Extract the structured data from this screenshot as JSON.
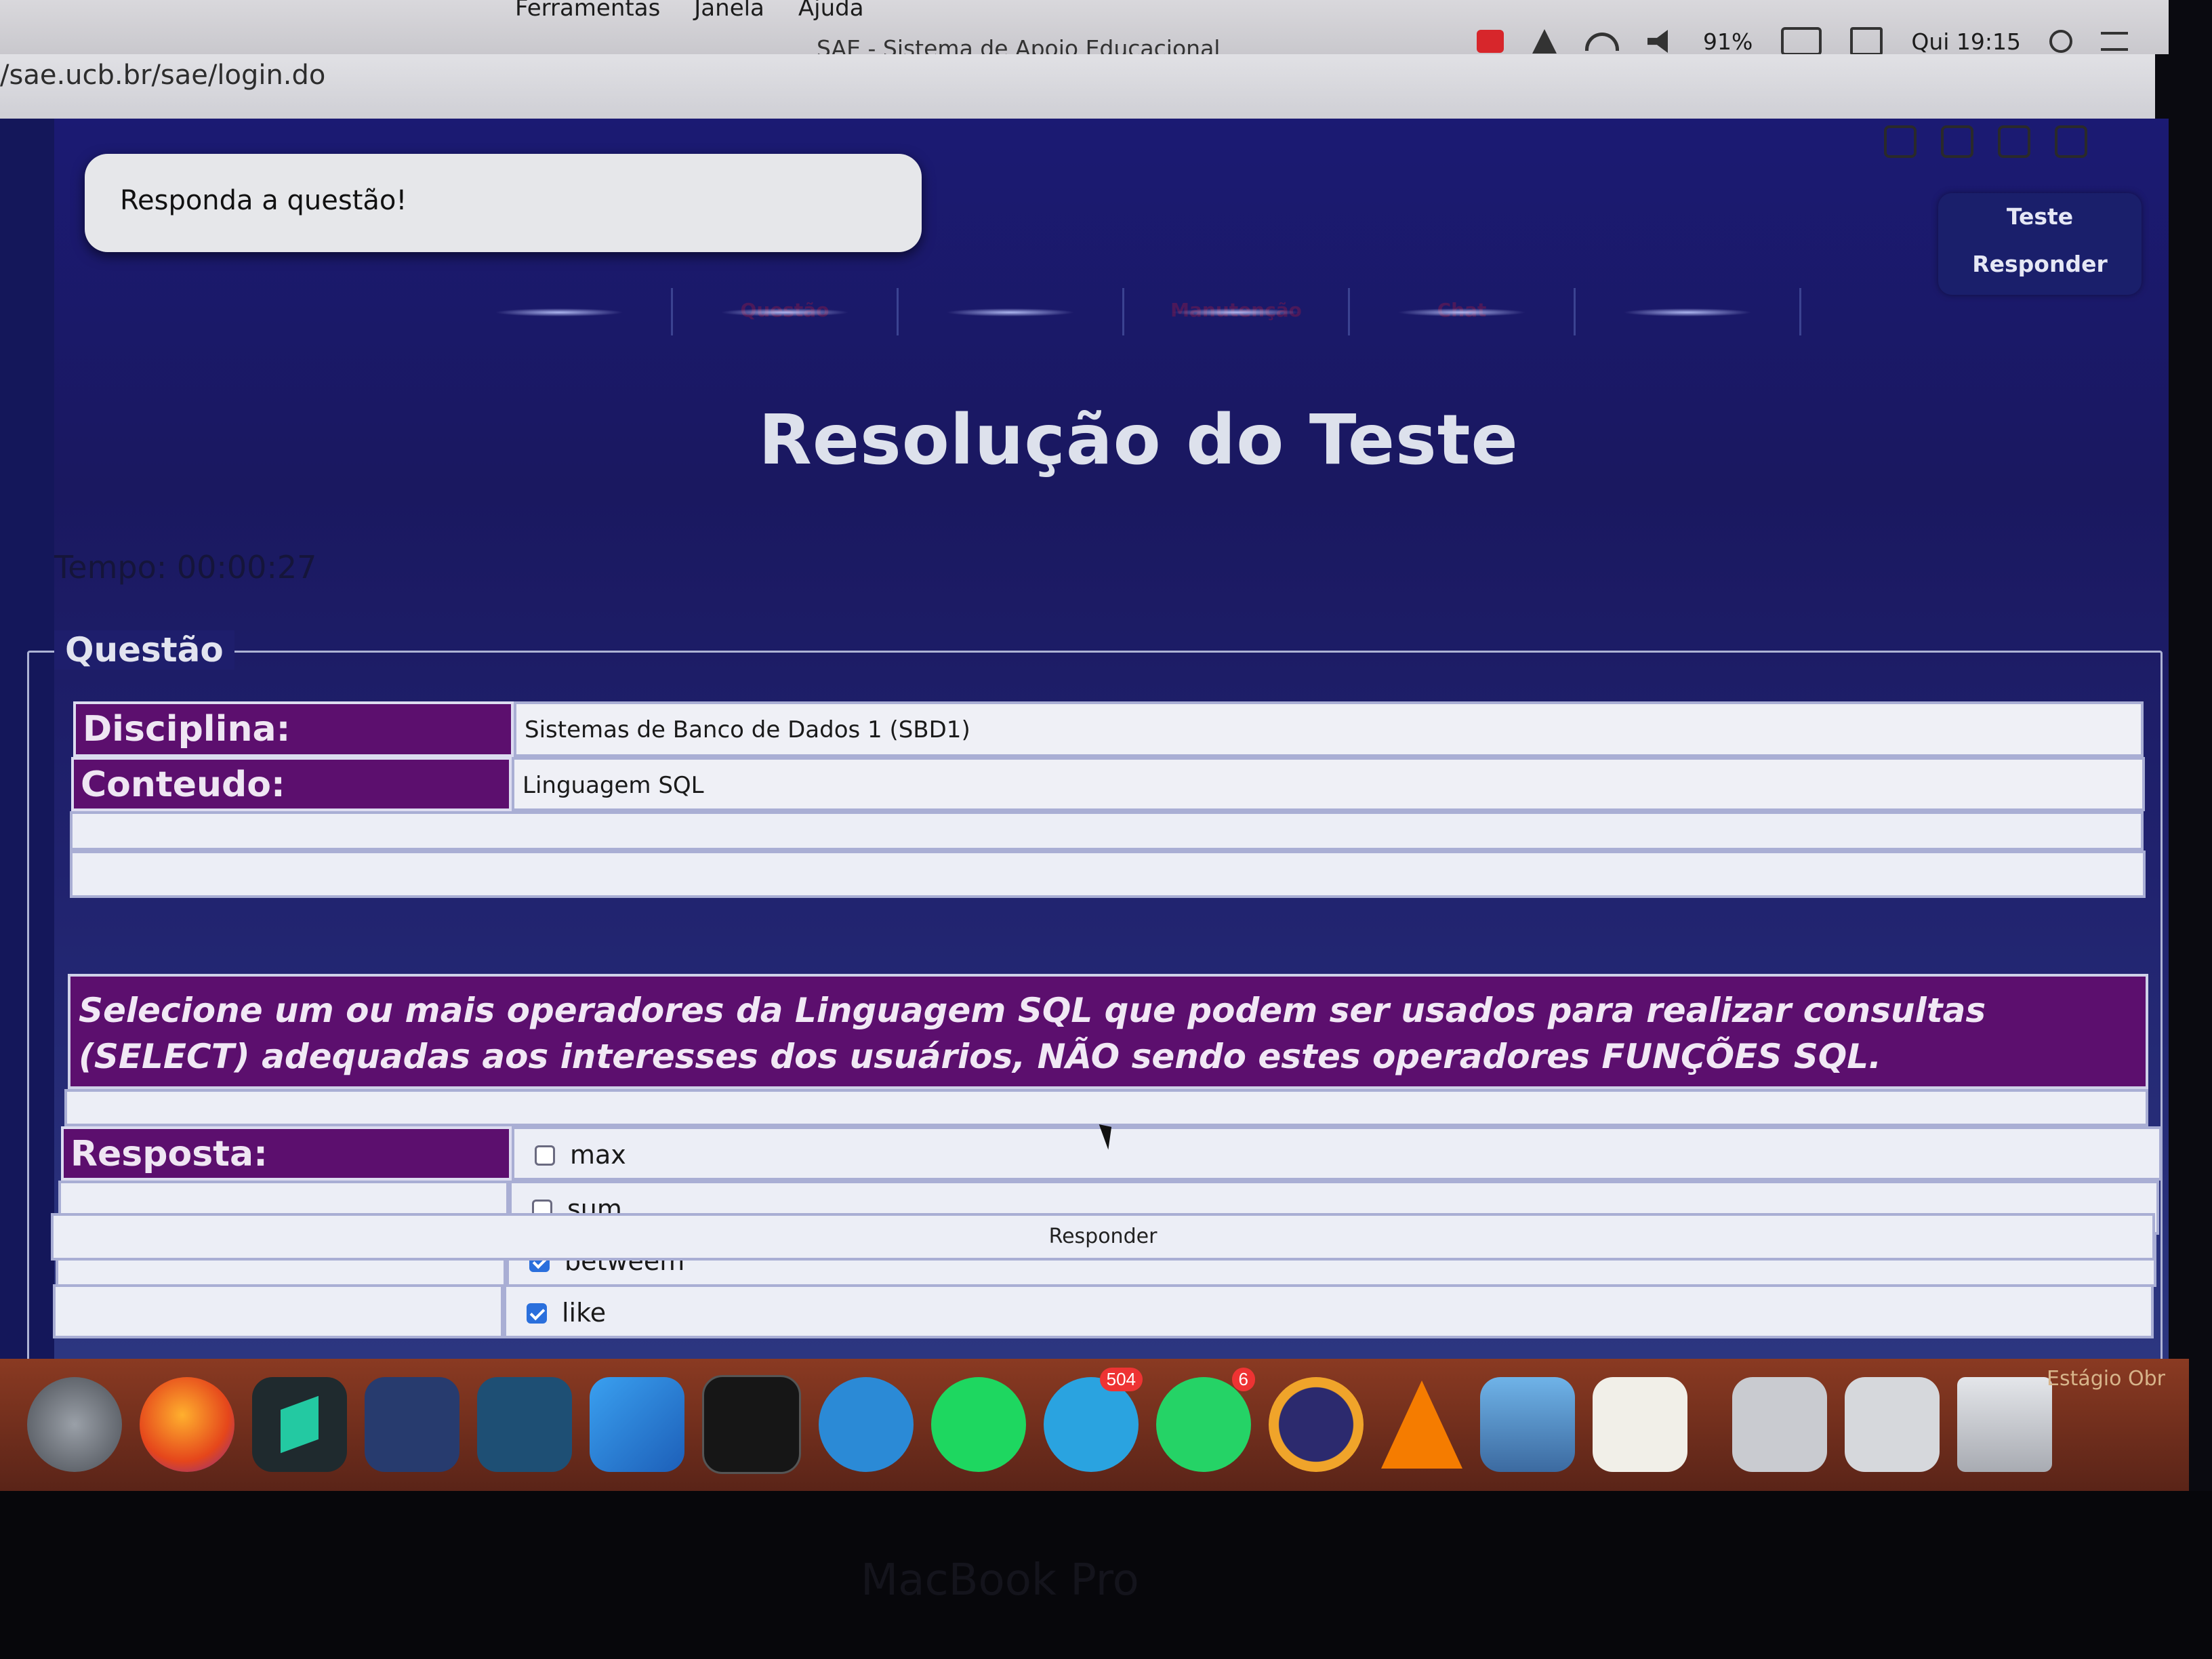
{
  "menubar": {
    "menus": [
      "Ferramentas",
      "Janela",
      "Ajuda"
    ],
    "window_title": "SAE - Sistema de Apoio Educacional",
    "battery": "91%",
    "clock": "Qui 19:15"
  },
  "browser": {
    "url": "/sae.ucb.br/sae/login.do"
  },
  "page": {
    "instruction": "Responda a questão!",
    "top_buttons": [
      "Teste",
      "Responder"
    ],
    "nav_tabs": [
      "",
      "Questão",
      "",
      "Manutenção",
      "Chat",
      ""
    ],
    "title": "Resolução do Teste",
    "timer": "Tempo: 00:00:27",
    "fieldset_legend": "Questão",
    "discipline_label": "Disciplina:",
    "discipline_value": "Sistemas de Banco de Dados 1 (SBD1)",
    "content_label": "Conteudo:",
    "content_value": "Linguagem SQL",
    "question_text": "Selecione um ou mais operadores da Linguagem SQL que podem ser usados para realizar consultas (SELECT) adequadas aos interesses dos usuários, NÃO sendo estes operadores FUNÇÕES SQL.",
    "answer_label": "Resposta:",
    "options": [
      {
        "label": "max",
        "checked": false
      },
      {
        "label": "sum",
        "checked": false
      },
      {
        "label": "betweem",
        "checked": true
      },
      {
        "label": "like",
        "checked": true
      }
    ],
    "submit_label": "Responder"
  },
  "dock": {
    "apps": [
      "launchpad-icon",
      "firefox-icon",
      "sublime-icon",
      "vscode-icon",
      "mysql-workbench-icon",
      "xcode-icon",
      "terminal-icon",
      "docker-icon",
      "spotify-icon",
      "telegram-icon",
      "whatsapp-icon",
      "eclipse-icon",
      "vlc-icon",
      "preview-icon",
      "java-icon"
    ],
    "telegram_badge": "504",
    "whatsapp_badge": "6",
    "stack_label": "Estágio Obr"
  },
  "device_label": "MacBook Pro",
  "colors": {
    "page_background": "#1b1a73",
    "header_cell": "#5c0f6e",
    "value_cell": "#eff0f6",
    "checkbox_checked": "#2a6fdc"
  }
}
